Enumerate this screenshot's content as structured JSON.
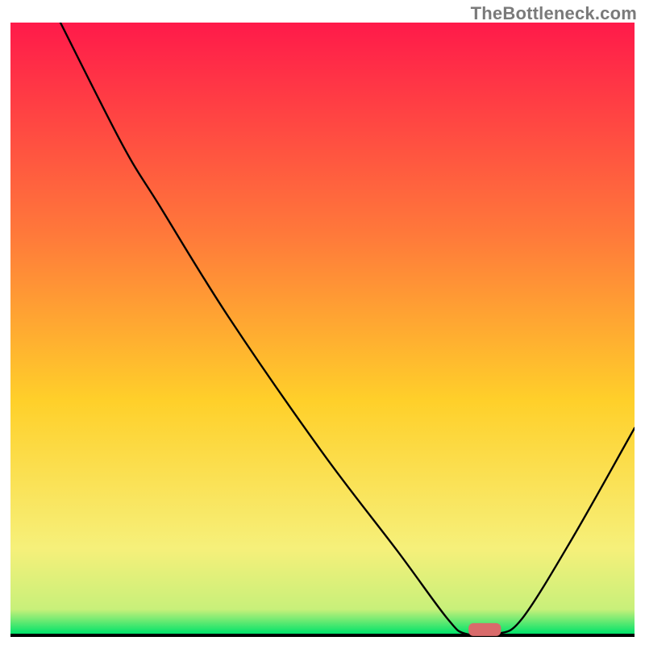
{
  "watermark": "TheBottleneck.com",
  "chart_data": {
    "type": "line",
    "title": "",
    "xlabel": "",
    "ylabel": "",
    "xlim": [
      0,
      100
    ],
    "ylim": [
      0,
      100
    ],
    "gradient_background": {
      "top_color": "#ff1a4a",
      "mid_color_1": "#ff7a3a",
      "mid_color_2": "#ffd02a",
      "lower_color": "#f6f07a",
      "bottom_color": "#00e36a"
    },
    "series": [
      {
        "name": "bottleneck-curve",
        "stroke": "#000000",
        "stroke_width": 2.4,
        "points": [
          {
            "x": 8,
            "y": 100
          },
          {
            "x": 18,
            "y": 80
          },
          {
            "x": 24,
            "y": 70
          },
          {
            "x": 35,
            "y": 52
          },
          {
            "x": 50,
            "y": 30
          },
          {
            "x": 62,
            "y": 14
          },
          {
            "x": 70,
            "y": 3
          },
          {
            "x": 73,
            "y": 0.5
          },
          {
            "x": 78,
            "y": 0.5
          },
          {
            "x": 82,
            "y": 3
          },
          {
            "x": 90,
            "y": 16
          },
          {
            "x": 100,
            "y": 34
          }
        ]
      }
    ],
    "marker": {
      "name": "optimal-point",
      "x": 76,
      "y": 1.2,
      "shape": "rounded-bar",
      "fill": "#d96b6b",
      "width_pct": 5.2,
      "height_pct": 2.1
    }
  }
}
